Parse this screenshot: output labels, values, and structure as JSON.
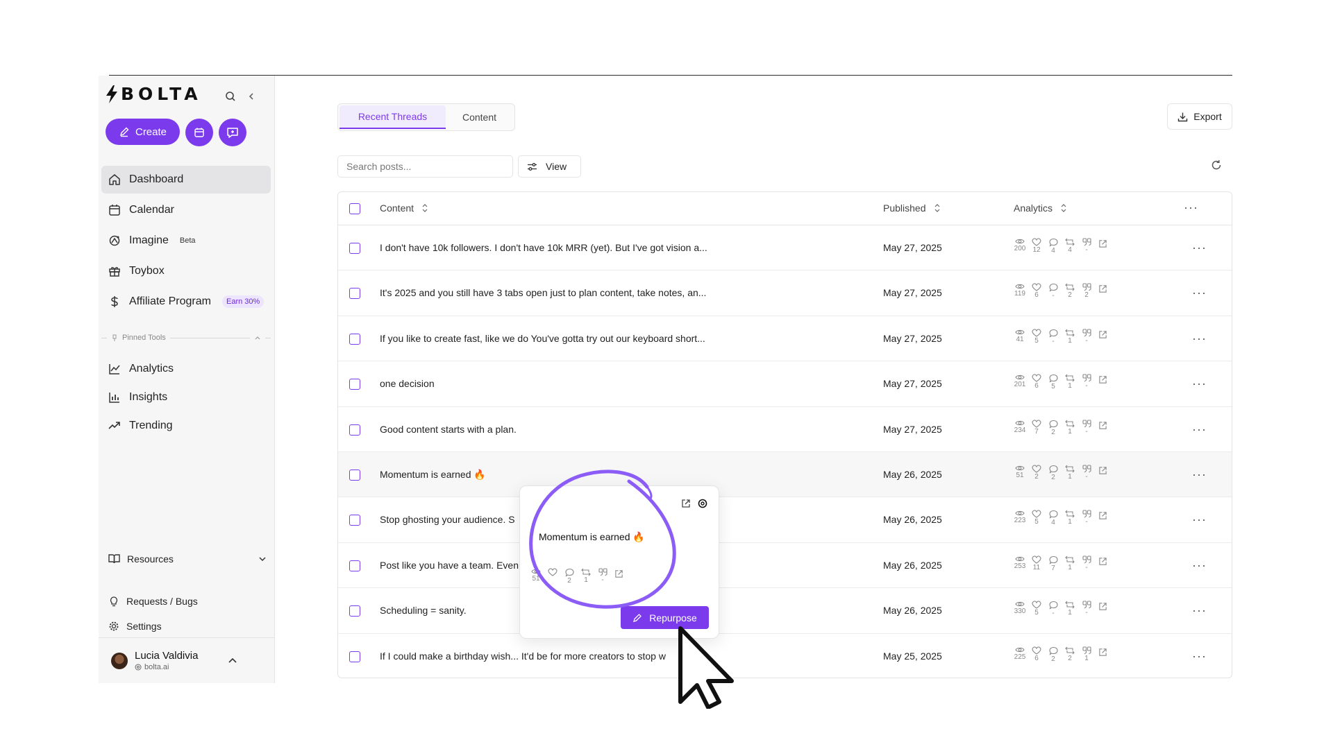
{
  "app": {
    "name": "BOLTA"
  },
  "sidebar": {
    "create_label": "Create",
    "nav": [
      {
        "label": "Dashboard",
        "icon": "home-icon",
        "active": true
      },
      {
        "label": "Calendar",
        "icon": "calendar-icon"
      },
      {
        "label": "Imagine",
        "icon": "imagine-icon",
        "badge": "Beta"
      },
      {
        "label": "Toybox",
        "icon": "gift-icon"
      },
      {
        "label": "Affiliate Program",
        "icon": "dollar-icon",
        "badge": "Earn 30%"
      }
    ],
    "pinned_label": "Pinned Tools",
    "pinned": [
      {
        "label": "Analytics",
        "icon": "line-chart-icon"
      },
      {
        "label": "Insights",
        "icon": "bar-chart-icon"
      },
      {
        "label": "Trending",
        "icon": "trending-icon"
      }
    ],
    "resources_label": "Resources",
    "bottom": [
      {
        "label": "Requests / Bugs",
        "icon": "lightbulb-icon"
      },
      {
        "label": "Settings",
        "icon": "gear-icon"
      }
    ],
    "user": {
      "name": "Lucia Valdivia",
      "handle": "bolta.ai"
    }
  },
  "main": {
    "tabs": [
      "Recent Threads",
      "Content"
    ],
    "export_label": "Export",
    "search_placeholder": "Search posts...",
    "view_label": "View",
    "columns": {
      "content": "Content",
      "published": "Published",
      "analytics": "Analytics"
    },
    "rows": [
      {
        "content": "I don't have 10k followers. I don't have 10k MRR (yet). But I've got vision a...",
        "date": "May 27, 2025",
        "metrics": [
          "200",
          "12",
          "4",
          "4",
          "-"
        ]
      },
      {
        "content": "It's 2025 and you still have 3 tabs open just to plan content, take notes, an...",
        "date": "May 27, 2025",
        "metrics": [
          "119",
          "6",
          "-",
          "2",
          "2"
        ]
      },
      {
        "content": "If you like to create fast, like we do You've gotta try out our keyboard short...",
        "date": "May 27, 2025",
        "metrics": [
          "41",
          "5",
          "-",
          "1",
          "-"
        ]
      },
      {
        "content": "one decision",
        "date": "May 27, 2025",
        "metrics": [
          "201",
          "6",
          "5",
          "1",
          "-"
        ]
      },
      {
        "content": "Good content starts with a plan.",
        "date": "May 27, 2025",
        "metrics": [
          "234",
          "7",
          "2",
          "1",
          "-"
        ]
      },
      {
        "content": "Momentum is earned 🔥",
        "date": "May 26, 2025",
        "metrics": [
          "51",
          "2",
          "2",
          "1",
          "-"
        ]
      },
      {
        "content": "Stop ghosting your audience. S",
        "date": "May 26, 2025",
        "metrics": [
          "223",
          "5",
          "4",
          "1",
          "-"
        ]
      },
      {
        "content": "Post like you have a team. Even",
        "date": "May 26, 2025",
        "metrics": [
          "253",
          "11",
          "7",
          "1",
          "-"
        ]
      },
      {
        "content": "Scheduling = sanity.",
        "date": "May 26, 2025",
        "metrics": [
          "330",
          "5",
          "-",
          "1",
          "-"
        ]
      },
      {
        "content": "If I could make a birthday wish... It'd be for more creators to stop w",
        "date": "May 25, 2025",
        "metrics": [
          "225",
          "6",
          "2",
          "2",
          "1"
        ]
      }
    ]
  },
  "popover": {
    "text": "Momentum is earned 🔥",
    "metrics": [
      "51",
      "",
      "2",
      "1",
      "-"
    ],
    "repurpose_label": "Repurpose"
  },
  "colors": {
    "accent": "#7c3aed",
    "annotation": "#8b5cf6"
  }
}
